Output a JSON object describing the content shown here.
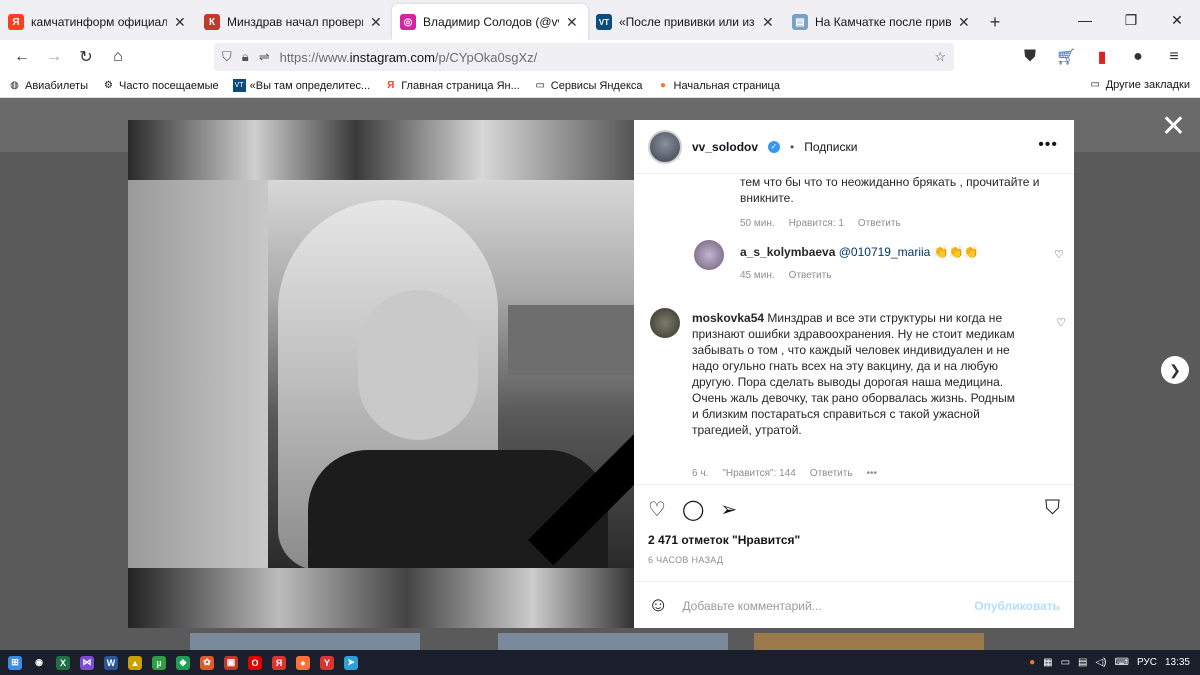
{
  "tabs": [
    {
      "title": "камчатинформ официальный",
      "icon": "yandex-icon",
      "color": "#fc3f1d",
      "glyph": "Я"
    },
    {
      "title": "Минздрав начал проверку по",
      "icon": "news-icon",
      "color": "#c0392b",
      "glyph": "К"
    },
    {
      "title": "Владимир Солодов (@vv_solo",
      "icon": "instagram-icon",
      "color": "#d6249f",
      "glyph": "◎"
    },
    {
      "title": "«После прививки или из-за пр",
      "icon": "vt-icon",
      "color": "#0a4d7a",
      "glyph": "VT"
    },
    {
      "title": "На Камчатке после прививки",
      "icon": "page-icon",
      "color": "#7aa0c4",
      "glyph": "▤"
    }
  ],
  "url": {
    "prefix": "https://www.",
    "domain": "instagram.com",
    "path": "/p/CYpOka0sgXz/"
  },
  "bookmarks": [
    {
      "label": "Авиабилеты",
      "icon": "globe-icon",
      "glyph": "🌐"
    },
    {
      "label": "Часто посещаемые",
      "icon": "gear-icon",
      "glyph": "⚙"
    },
    {
      "label": "«Вы там определитес...",
      "icon": "vt-icon",
      "glyph": "VT"
    },
    {
      "label": "Главная страница Ян...",
      "icon": "yandex-icon",
      "glyph": "Я"
    },
    {
      "label": "Сервисы Яндекса",
      "icon": "folder-icon",
      "glyph": "🗀"
    },
    {
      "label": "Начальная страница",
      "icon": "firefox-icon",
      "glyph": "●"
    }
  ],
  "bookmarks_other": "Другие закладки",
  "post": {
    "username": "vv_solodov",
    "follow": "Подписки",
    "likes": "2 471 отметок \"Нравится\"",
    "ago": "6 ЧАСОВ НАЗАД",
    "add_comment_placeholder": "Добавьте комментарий...",
    "publish": "Опубликовать"
  },
  "comments": {
    "c1": {
      "text": "тем что бы что то неожиданно брякать , прочитайте и вникните.",
      "time": "50 мин.",
      "likes": "Нравится: 1",
      "reply": "Ответить"
    },
    "c2": {
      "user": "a_s_kolymbaeva",
      "mention": "@010719_mariia",
      "emoji": "👏👏👏",
      "time": "45 мин.",
      "reply": "Ответить"
    },
    "c3": {
      "user": "moskovka54",
      "text": "Минздрав и все эти структуры ни когда не признают ошибки здравоохранения. Ну не стоит медикам забывать о том , что каждый человек индивидуален и не надо огульно гнать всех на эту вакцину, да и на любую другую. Пора сделать выводы дорогая наша медицина. Очень жаль девочку, так рано оборвалась жизнь. Родным и близким постараться справиться с такой ужасной трагедией, утратой.",
      "time": "6 ч.",
      "likes": "\"Нравится\": 144",
      "reply": "Ответить",
      "more": "•••"
    }
  },
  "taskbar": {
    "lang": "РУС",
    "time": "13:35"
  }
}
